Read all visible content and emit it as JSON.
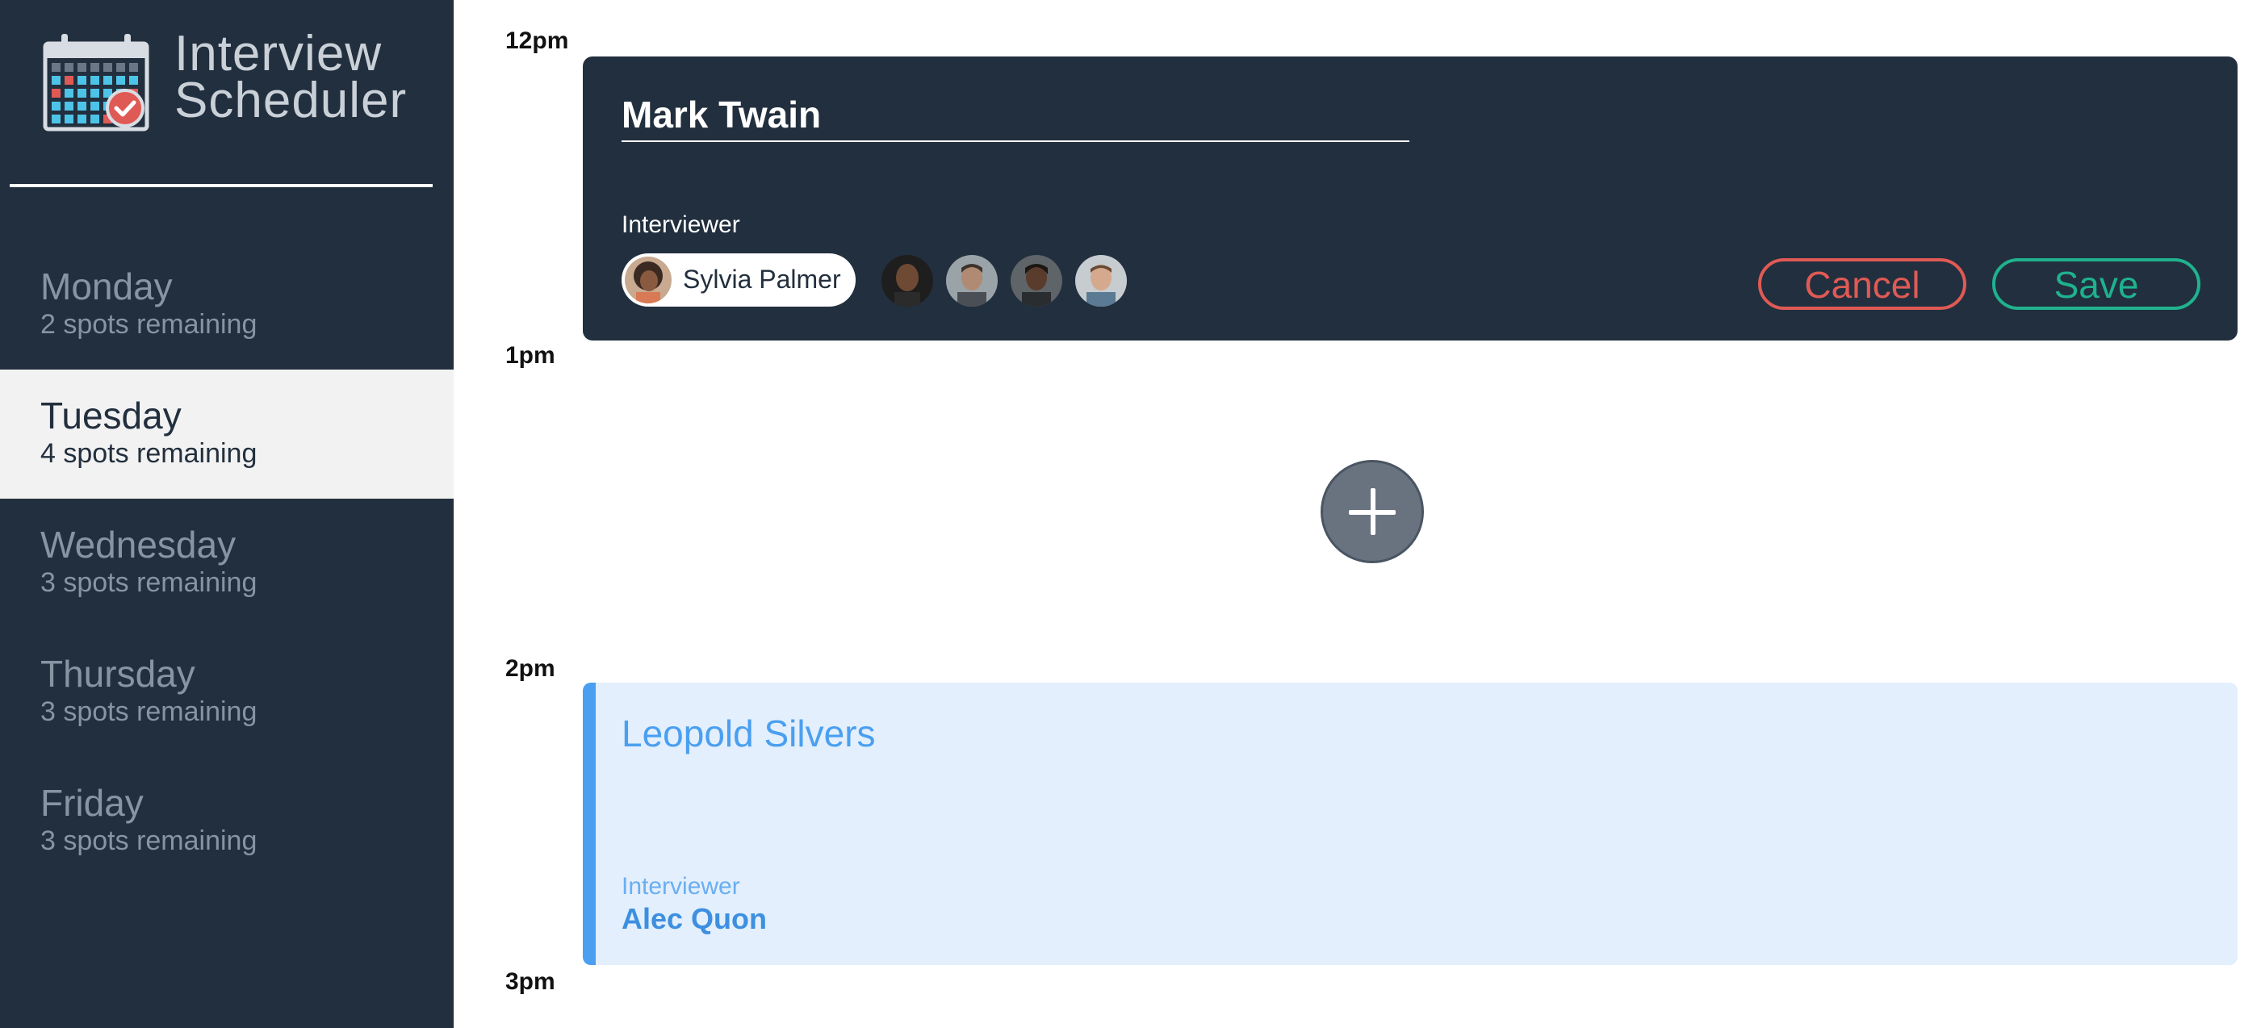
{
  "app": {
    "title_line1": "Interview",
    "title_line2": "Scheduler"
  },
  "sidebar": {
    "days": [
      {
        "name": "Monday",
        "spots": "2 spots remaining",
        "selected": false
      },
      {
        "name": "Tuesday",
        "spots": "4 spots remaining",
        "selected": true
      },
      {
        "name": "Wednesday",
        "spots": "3 spots remaining",
        "selected": false
      },
      {
        "name": "Thursday",
        "spots": "3 spots remaining",
        "selected": false
      },
      {
        "name": "Friday",
        "spots": "3 spots remaining",
        "selected": false
      }
    ]
  },
  "schedule": {
    "times": [
      "12pm",
      "1pm",
      "2pm",
      "3pm"
    ],
    "form": {
      "student_name": "Mark Twain",
      "interviewer_label": "Interviewer",
      "selected_interviewer": "Sylvia Palmer",
      "other_interviewer_count": 4,
      "cancel_label": "Cancel",
      "save_label": "Save"
    },
    "add_icon": "plus-icon",
    "appointment": {
      "student": "Leopold Silvers",
      "interviewer_label": "Interviewer",
      "interviewer": "Alec Quon"
    }
  },
  "colors": {
    "sidebar_bg": "#222f3e",
    "cancel": "#e05a55",
    "save": "#1fb28e",
    "appointment_accent": "#4a9ff0",
    "appointment_bg": "#e3effc"
  }
}
